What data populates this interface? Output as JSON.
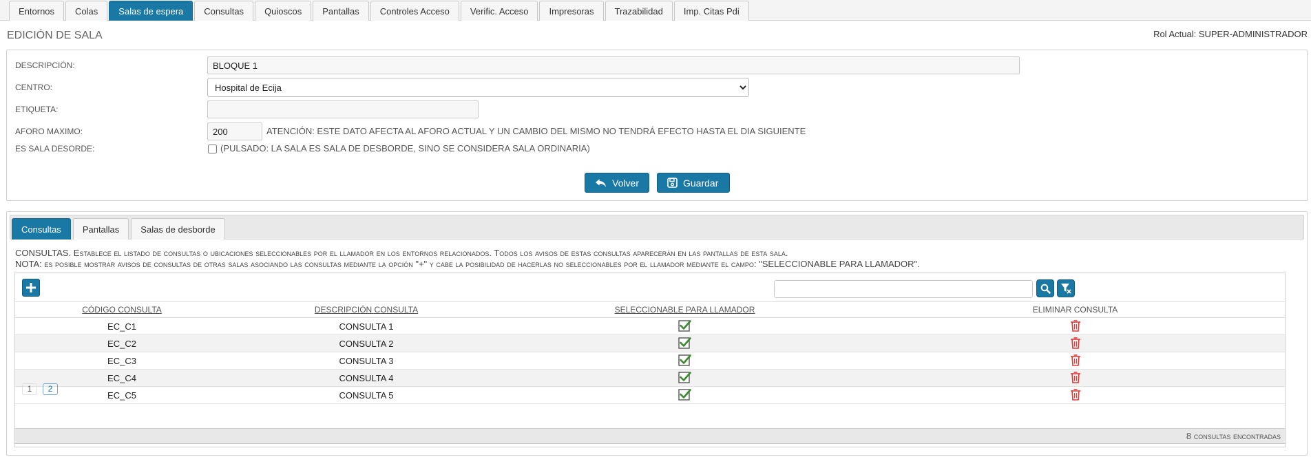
{
  "top_tabs": [
    {
      "label": "Entornos",
      "active": false
    },
    {
      "label": "Colas",
      "active": false
    },
    {
      "label": "Salas de espera",
      "active": true
    },
    {
      "label": "Consultas",
      "active": false
    },
    {
      "label": "Quioscos",
      "active": false
    },
    {
      "label": "Pantallas",
      "active": false
    },
    {
      "label": "Controles Acceso",
      "active": false
    },
    {
      "label": "Verific. Acceso",
      "active": false
    },
    {
      "label": "Impresoras",
      "active": false
    },
    {
      "label": "Trazabilidad",
      "active": false
    },
    {
      "label": "Imp. Citas Pdi",
      "active": false
    }
  ],
  "header": {
    "title": "EDICIÓN DE SALA",
    "role": "Rol Actual: SUPER-ADMINISTRADOR"
  },
  "form": {
    "descripcion_label": "DESCRIPCIÓN:",
    "descripcion_value": "BLOQUE 1",
    "centro_label": "CENTRO:",
    "centro_value": "Hospital de Ecija",
    "etiqueta_label": "ETIQUETA:",
    "etiqueta_value": "",
    "aforo_label": "AFORO MAXIMO:",
    "aforo_value": "200",
    "aforo_note": "ATENCIÓN: ESTE DATO AFECTA AL AFORO ACTUAL Y UN CAMBIO DEL MISMO NO TENDRÁ EFECTO HASTA EL DIA SIGUIENTE",
    "desborde_label": "ES SALA DESORDE:",
    "desborde_checked": false,
    "desborde_note": "(PULSADO: LA SALA ES SALA DE DESBORDE, SINO SE CONSIDERA SALA ORDINARIA)",
    "volver_label": "Volver",
    "guardar_label": "Guardar"
  },
  "sub_tabs": [
    {
      "label": "Consultas",
      "active": true
    },
    {
      "label": "Pantallas",
      "active": false
    },
    {
      "label": "Salas de desborde",
      "active": false
    }
  ],
  "info": {
    "line1_lead": "CONSULTAS.",
    "line1_rest": "Establece el listado de consultas o ubicaciones seleccionables por el llamador en los entornos relacionados. Todos los avisos de estas consultas aparecerán en las pantallas de esta sala.",
    "line2_lead": "NOTA:",
    "line2_rest": "es posible mostrar avisos de consultas de otras salas asociando las consultas mediante la opción \"+\" y cabe la posibilidad de hacerlas no seleccionables por el llamador mediante el campo:",
    "line2_tail": "\"SELECCIONABLE PARA LLAMADOR\"."
  },
  "table": {
    "columns": [
      "CÓDIGO CONSULTA",
      "DESCRIPCIÓN CONSULTA",
      "SELECCIONABLE PARA LLAMADOR",
      "ELIMINAR CONSULTA"
    ],
    "rows": [
      {
        "codigo": "EC_C1",
        "descripcion": "CONSULTA 1",
        "seleccionable": true
      },
      {
        "codigo": "EC_C2",
        "descripcion": "CONSULTA 2",
        "seleccionable": true
      },
      {
        "codigo": "EC_C3",
        "descripcion": "CONSULTA 3",
        "seleccionable": true
      },
      {
        "codigo": "EC_C4",
        "descripcion": "CONSULTA 4",
        "seleccionable": true
      },
      {
        "codigo": "EC_C5",
        "descripcion": "CONSULTA 5",
        "seleccionable": true
      }
    ],
    "pages": [
      "1",
      "2"
    ],
    "current_page": "2",
    "footer_count": "8",
    "footer_text": "consultas encontradas"
  },
  "icons": {
    "add": "plus-icon",
    "search": "search-icon",
    "filter": "filter-clear-icon",
    "check": "checkbox-checked-icon",
    "delete": "trash-icon",
    "volver": "undo-arrow-icon",
    "guardar": "floppy-disk-icon"
  },
  "colors": {
    "primary": "#1a78a5",
    "check_green": "#3a8a2e",
    "trash_red": "#e53935"
  }
}
